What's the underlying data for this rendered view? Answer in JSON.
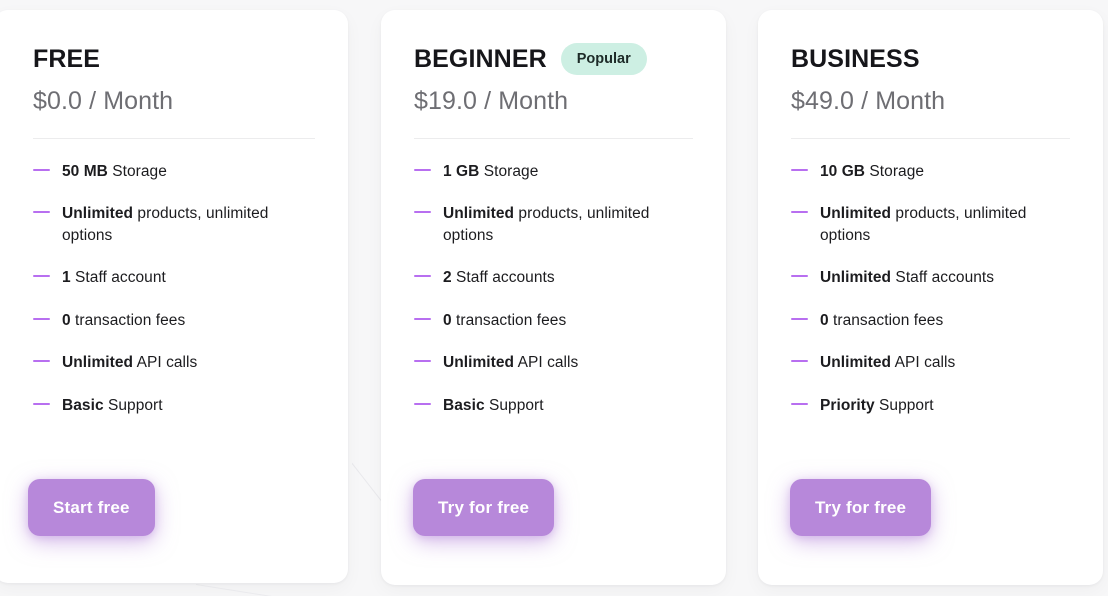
{
  "theme": {
    "page_background": "#f7f7f8",
    "card_background": "#ffffff",
    "accent_purple": "#b788da",
    "bullet_purple": "#b86ff0",
    "badge_background": "#cdefe3",
    "price_text": "#6e6e73",
    "title_text": "#16161a"
  },
  "plans": [
    {
      "name": "FREE",
      "badge": null,
      "price": "$0.0 / Month",
      "cta_label": "Start free",
      "features": [
        {
          "strong": "50 MB",
          "rest": " Storage"
        },
        {
          "strong": "Unlimited",
          "rest": " products, unlimited options"
        },
        {
          "strong": "1",
          "rest": " Staff account"
        },
        {
          "strong": "0",
          "rest": " transaction fees"
        },
        {
          "strong": "Unlimited",
          "rest": " API calls"
        },
        {
          "strong": "Basic",
          "rest": " Support"
        }
      ]
    },
    {
      "name": "BEGINNER",
      "badge": "Popular",
      "price": "$19.0 / Month",
      "cta_label": "Try for free",
      "features": [
        {
          "strong": "1 GB",
          "rest": " Storage"
        },
        {
          "strong": "Unlimited",
          "rest": " products, unlimited options"
        },
        {
          "strong": "2",
          "rest": " Staff accounts"
        },
        {
          "strong": "0",
          "rest": " transaction fees"
        },
        {
          "strong": "Unlimited",
          "rest": " API calls"
        },
        {
          "strong": "Basic",
          "rest": " Support"
        }
      ]
    },
    {
      "name": "BUSINESS",
      "badge": null,
      "price": "$49.0 / Month",
      "cta_label": "Try for free",
      "features": [
        {
          "strong": "10 GB",
          "rest": " Storage"
        },
        {
          "strong": "Unlimited",
          "rest": " products, unlimited options"
        },
        {
          "strong": "Unlimited",
          "rest": " Staff accounts"
        },
        {
          "strong": "0",
          "rest": " transaction fees"
        },
        {
          "strong": "Unlimited",
          "rest": " API calls"
        },
        {
          "strong": "Priority",
          "rest": " Support"
        }
      ]
    }
  ]
}
